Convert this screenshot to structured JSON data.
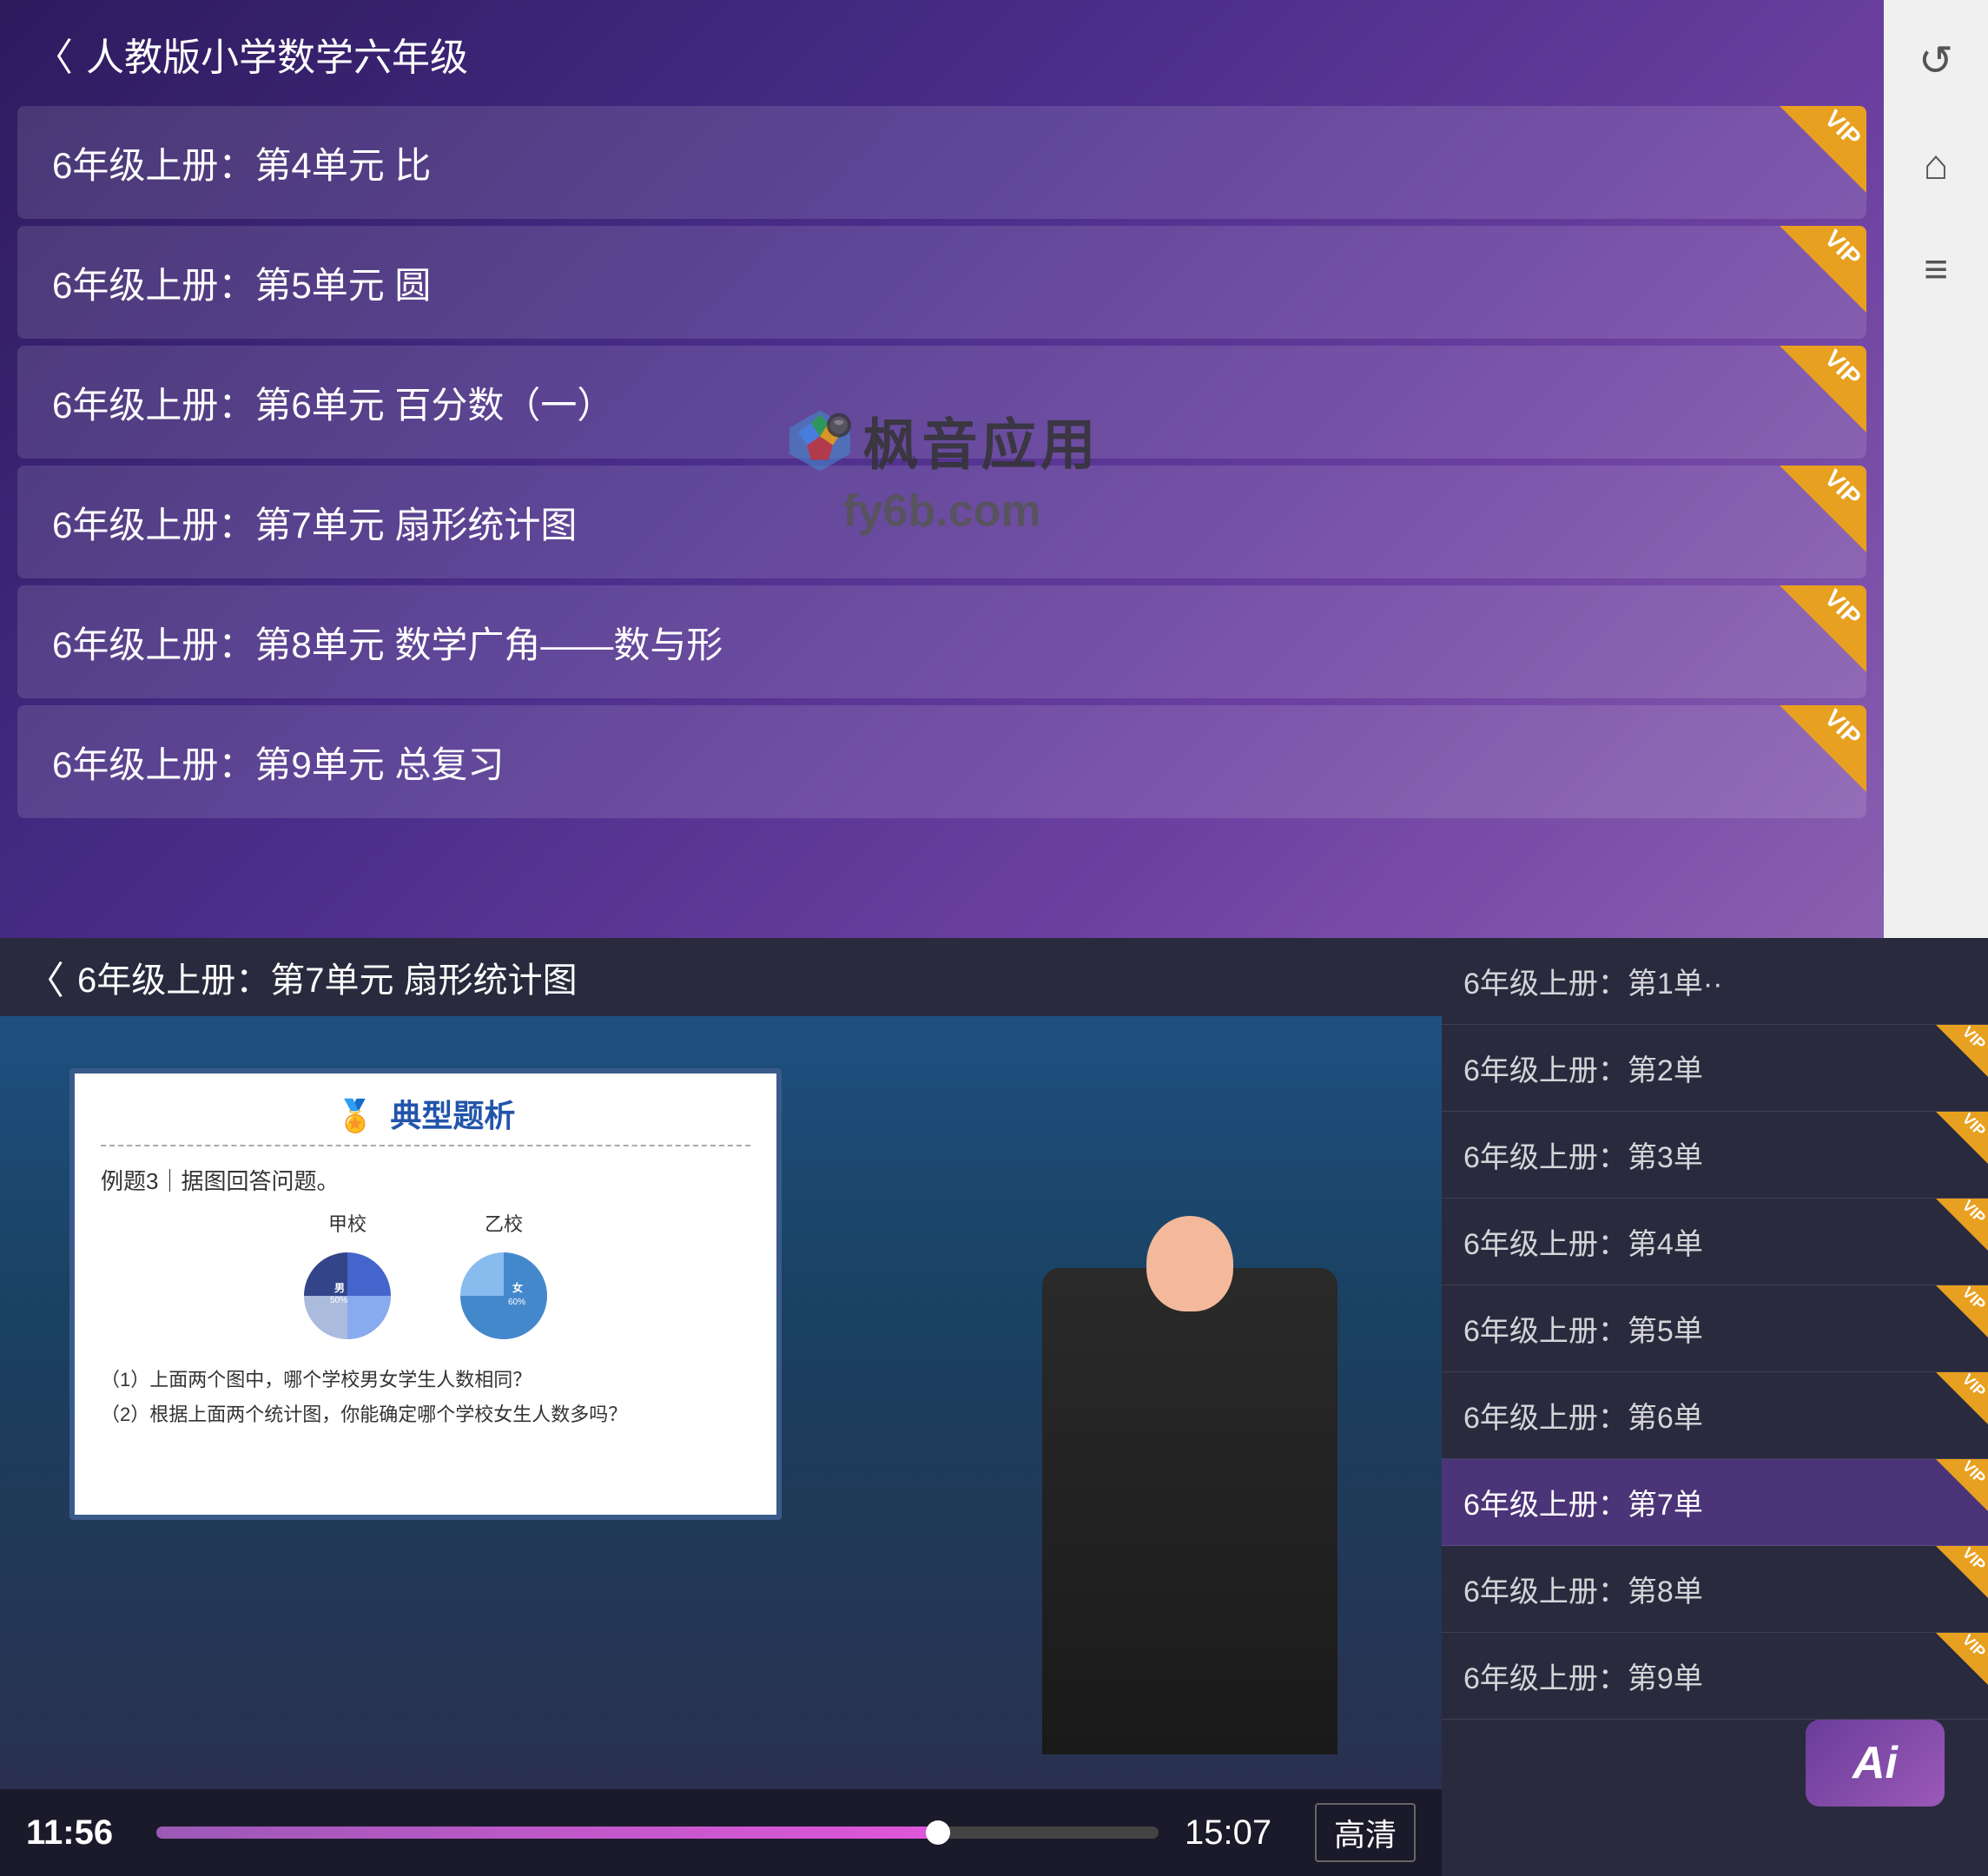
{
  "app": {
    "title": "人教版小学数学六年级",
    "watermark_text": "枫音应用",
    "watermark_url": "fy6b.com"
  },
  "top_section": {
    "back_label": "人教版小学数学六年级",
    "course_items": [
      {
        "id": 1,
        "label": "6年级上册：第4单元 比",
        "vip": true
      },
      {
        "id": 2,
        "label": "6年级上册：第5单元 圆",
        "vip": true
      },
      {
        "id": 3,
        "label": "6年级上册：第6单元 百分数（一）",
        "vip": true
      },
      {
        "id": 4,
        "label": "6年级上册：第7单元 扇形统计图",
        "vip": true
      },
      {
        "id": 5,
        "label": "6年级上册：第8单元 数学广角——数与形",
        "vip": true
      },
      {
        "id": 6,
        "label": "6年级上册：第9单元 总复习",
        "vip": true
      }
    ],
    "vip_text": "VIP"
  },
  "right_sidebar": {
    "back_icon": "↺",
    "home_icon": "⌂",
    "menu_icon": "≡"
  },
  "bottom_section": {
    "video_header": {
      "back_label": "6年级上册：第7单元 扇形统计图"
    },
    "video": {
      "whiteboard_title": "典型题析",
      "example_label": "例题3｜据图回答问题。",
      "chart_left_label": "甲校",
      "chart_right_label": "乙校",
      "question1": "（1）上面两个图中，哪个学校男女学生人数相同？",
      "question2": "（2）根据上面两个统计图，你能确定哪个学校女生人数多吗？"
    },
    "controls": {
      "time_current": "11:56",
      "time_total": "15:07",
      "quality_label": "高清",
      "progress_percent": 78
    },
    "playlist": [
      {
        "id": 1,
        "label": "6年级上册：第1单··",
        "vip": false,
        "active": false
      },
      {
        "id": 2,
        "label": "6年级上册：第2单",
        "vip": true,
        "active": false
      },
      {
        "id": 3,
        "label": "6年级上册：第3单",
        "vip": true,
        "active": false
      },
      {
        "id": 4,
        "label": "6年级上册：第4单",
        "vip": true,
        "active": false
      },
      {
        "id": 5,
        "label": "6年级上册：第5单",
        "vip": true,
        "active": false
      },
      {
        "id": 6,
        "label": "6年级上册：第6单",
        "vip": true,
        "active": false
      },
      {
        "id": 7,
        "label": "6年级上册：第7单",
        "vip": true,
        "active": true
      },
      {
        "id": 8,
        "label": "6年级上册：第8单",
        "vip": true,
        "active": false
      },
      {
        "id": 9,
        "label": "6年级上册：第9单",
        "vip": true,
        "active": false
      }
    ]
  },
  "ai_button": {
    "label": "Ai"
  }
}
